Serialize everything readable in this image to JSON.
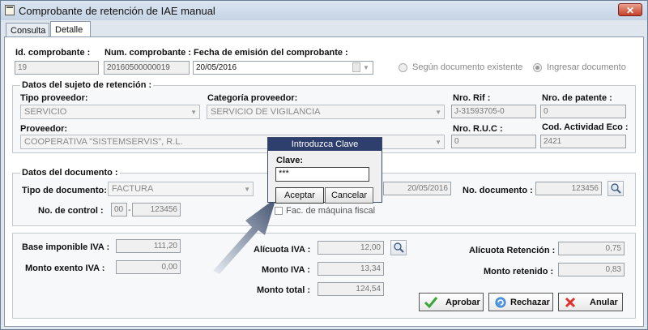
{
  "window": {
    "title": "Comprobante de retención de IAE manual",
    "close_label": "✕"
  },
  "tabs": [
    {
      "label": "Consulta"
    },
    {
      "label": "Detalle"
    }
  ],
  "header": {
    "id_label": "Id. comprobante :",
    "id_value": "19",
    "num_label": "Num. comprobante :",
    "num_value": "20160500000019",
    "fecha_label": "Fecha de emisión del comprobante :",
    "fecha_value": "20/05/2016",
    "radio1_label": "Según documento existente",
    "radio2_label": "Ingresar documento"
  },
  "sujeto": {
    "legend": "Datos del sujeto de retención :",
    "tipo_label": "Tipo proveedor:",
    "tipo_value": "SERVICIO",
    "categoria_label": "Categoría proveedor:",
    "categoria_value": "SERVICIO DE VIGILANCIA",
    "rif_label": "Nro. Rif :",
    "rif_value": "J-31593705-0",
    "patente_label": "Nro. de patente :",
    "patente_value": "0",
    "proveedor_label": "Proveedor:",
    "proveedor_value": "COOPERATIVA \"SISTEMSERVIS\", R.L.",
    "ruc_label": "Nro. R.U.C :",
    "ruc_value": "0",
    "actividad_label": "Cod. Actividad Eco :",
    "actividad_value": "2421"
  },
  "documento": {
    "legend": "Datos del documento :",
    "tipo_label": "Tipo de documento:",
    "tipo_value": "FACTURA",
    "fecha_value": "20/05/2016",
    "nodoc_label": "No. documento :",
    "nodoc_value": "123456",
    "control_label": "No. de control :",
    "control_prefix": "00",
    "control_sep": "-",
    "control_value": "123456",
    "maquina_label": "Fac. de máquina fiscal"
  },
  "montos": {
    "base_label": "Base imponible IVA :",
    "base_value": "111,20",
    "exento_label": "Monto exento IVA :",
    "exento_value": "0,00",
    "alicuota_label": "Alícuota IVA :",
    "alicuota_value": "12,00",
    "montoiva_label": "Monto IVA :",
    "montoiva_value": "13,34",
    "total_label": "Monto total :",
    "total_value": "124,54",
    "alic_ret_label": "Alícuota Retención :",
    "alic_ret_value": "0,75",
    "retenido_label": "Monto retenido :",
    "retenido_value": "0,83"
  },
  "actions": {
    "aprobar": "Aprobar",
    "rechazar": "Rechazar",
    "anular": "Anular"
  },
  "dialog": {
    "title": "Introduzca Clave",
    "clave_label": "Clave:",
    "clave_value": "***",
    "aceptar": "Aceptar",
    "cancelar": "Cancelar"
  },
  "colors": {
    "titlebar": "#c5d3e4",
    "dialog_title": "#2e3f6e",
    "aprobar_icon": "#3aa53a",
    "rechazar_icon": "#2e7bd0",
    "anular_icon": "#e03030"
  }
}
